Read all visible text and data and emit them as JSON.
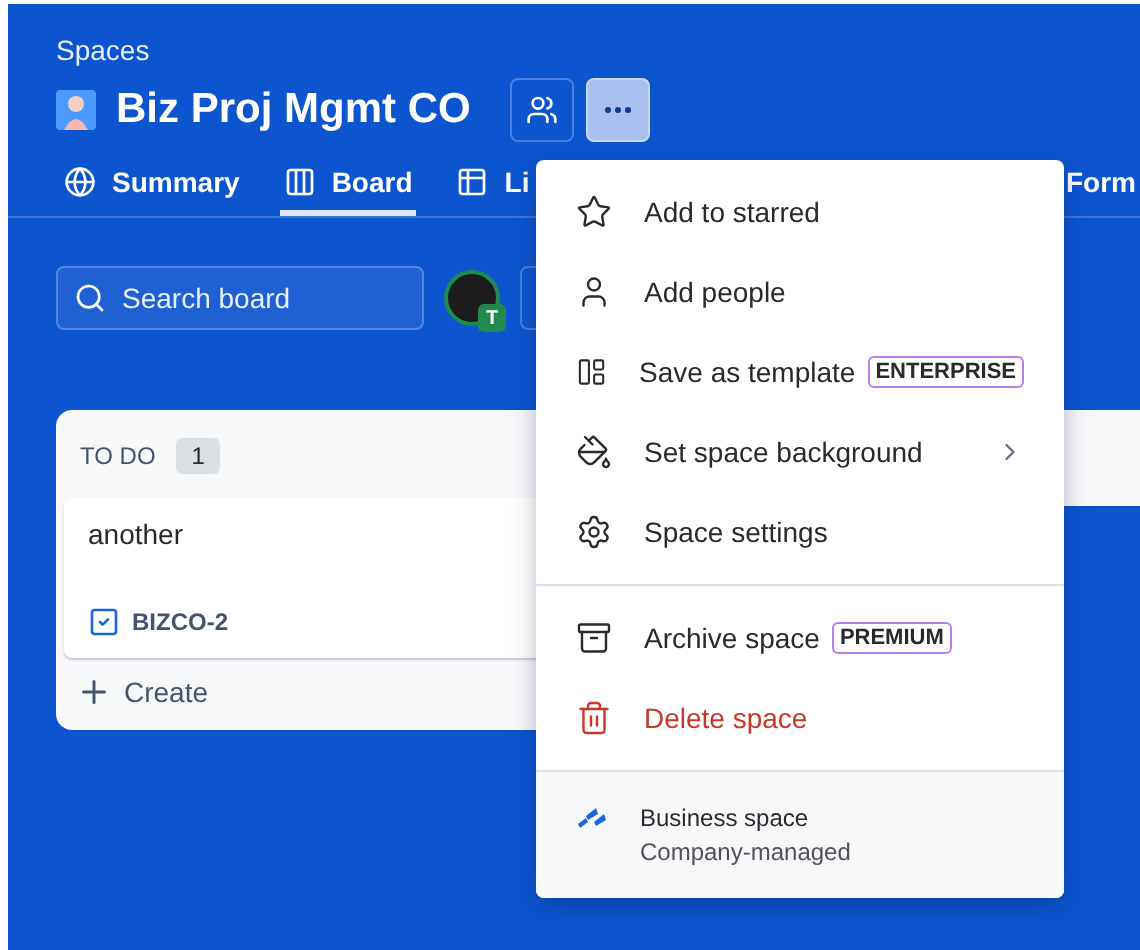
{
  "header": {
    "breadcrumb": "Spaces",
    "title": "Biz Proj Mgmt CO"
  },
  "tabs": [
    {
      "label": "Summary",
      "selected": false
    },
    {
      "label": "Board",
      "selected": true
    },
    {
      "label": "Li",
      "selected": false
    },
    {
      "label": "Form",
      "selected": false
    }
  ],
  "search": {
    "placeholder": "Search board"
  },
  "avatar": {
    "initial": "T"
  },
  "columns": [
    {
      "title": "TO DO",
      "count": "1",
      "cards": [
        {
          "title": "another",
          "key": "BIZCO-2"
        }
      ],
      "create": "Create"
    }
  ],
  "menu": {
    "sections": [
      [
        {
          "label": "Add to starred",
          "kind": "plain"
        },
        {
          "label": "Add people",
          "kind": "plain"
        },
        {
          "label": "Save as template",
          "kind": "badge",
          "badge": "ENTERPRISE"
        },
        {
          "label": "Set space background",
          "kind": "submenu"
        },
        {
          "label": "Space settings",
          "kind": "plain"
        }
      ],
      [
        {
          "label": "Archive space",
          "kind": "badge",
          "badge": "PREMIUM"
        },
        {
          "label": "Delete space",
          "kind": "danger"
        }
      ]
    ],
    "footer": {
      "title": "Business space",
      "subtitle": "Company-managed"
    }
  }
}
